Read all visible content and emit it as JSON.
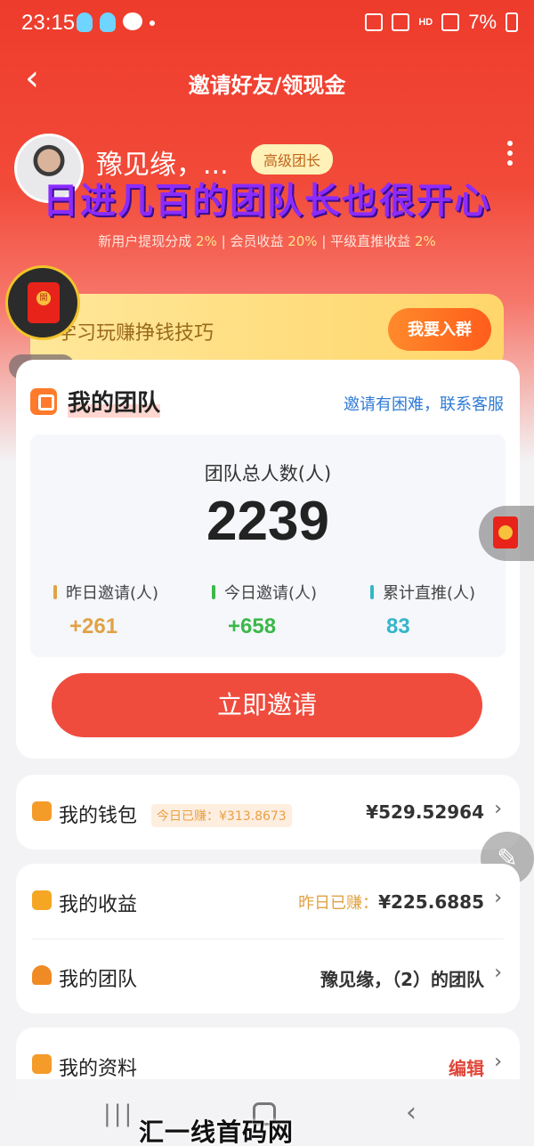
{
  "status_bar": {
    "time": "23:15",
    "battery": "7%",
    "network": "HD"
  },
  "nav": {
    "back_icon": "chevron-left-icon",
    "title": "邀请好友/领现金"
  },
  "profile": {
    "username": "豫见缘，...",
    "level_badge": "高级团长",
    "overlay_caption": "日进几百的团队长也很开心",
    "rates": [
      {
        "label": "新用户提现分成 ",
        "value": "2%"
      },
      {
        "label": "会员收益 ",
        "value": "20%"
      },
      {
        "label": "平级直推收益 ",
        "value": "2%"
      }
    ]
  },
  "group_banner": {
    "text": "学习玩赚挣钱技巧",
    "button": "我要入群"
  },
  "floating": {
    "redpack_label": "開",
    "pager": "3/3"
  },
  "team": {
    "title": "我的团队",
    "help_link": "邀请有困难，联系客服",
    "total_label": "团队总人数(人)",
    "total_value": "2239",
    "stats": [
      {
        "label": "昨日邀请(人)",
        "value": "+261",
        "color": "#e0a245"
      },
      {
        "label": "今日邀请(人)",
        "value": "+658",
        "color": "#3db84a"
      },
      {
        "label": "累计直推(人)",
        "value": "83",
        "color": "#35b6c8"
      }
    ],
    "invite_button": "立即邀请"
  },
  "wallet": {
    "label": "我的钱包",
    "today_tag": "今日已赚：¥313.8673",
    "balance": "¥529.52964"
  },
  "earnings": {
    "label": "我的收益",
    "yesterday_prefix": "昨日已赚：",
    "yesterday_value": "¥225.6885"
  },
  "my_team_row": {
    "label": "我的团队",
    "value": "豫见缘，（2）的团队"
  },
  "profile_row": {
    "label": "我的资料",
    "action": "编辑"
  },
  "watermark": "汇一线首码网 www.huiyixian.com"
}
